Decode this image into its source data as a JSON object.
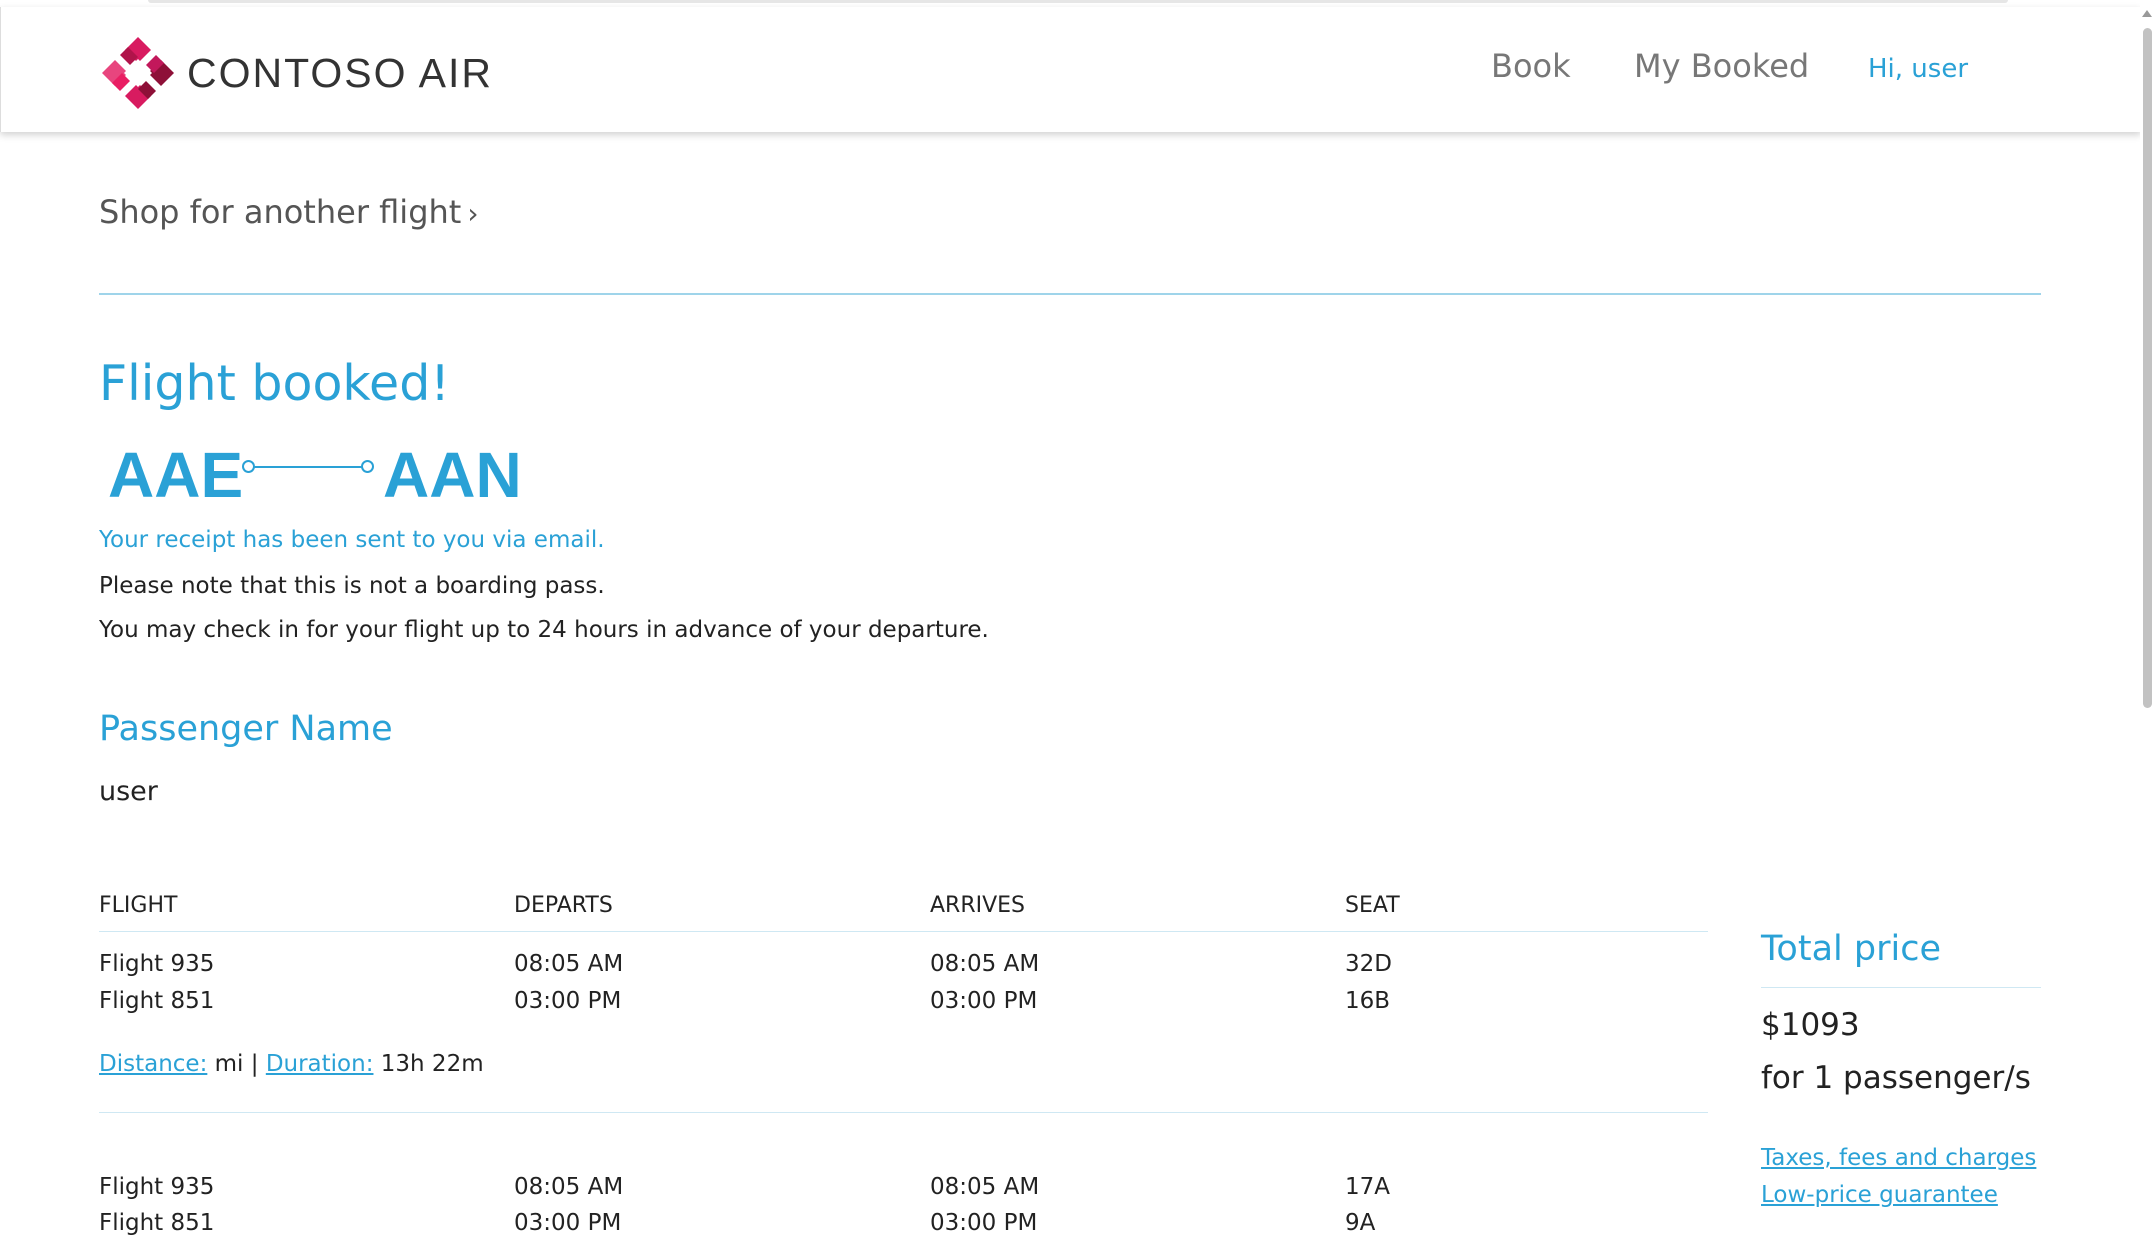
{
  "header": {
    "brand": "CONTOSO AIR",
    "nav": {
      "book": "Book",
      "my_booked": "My Booked"
    },
    "greeting": "Hi, user"
  },
  "shop_link": "Shop for another flight",
  "confirmation": {
    "title": "Flight booked!",
    "from_code": "AAE",
    "to_code": "AAN",
    "receipt": "Your receipt has been sent to you via email.",
    "note1": "Please note that this is not a boarding pass.",
    "note2": "You may check in for your flight up to 24 hours in advance of your departure."
  },
  "passenger": {
    "heading": "Passenger Name",
    "name": "user"
  },
  "table": {
    "headers": [
      "FLIGHT",
      "DEPARTS",
      "ARRIVES",
      "SEAT"
    ],
    "groups": [
      {
        "rows": [
          [
            "Flight 935",
            "08:05 AM",
            "08:05 AM",
            "32D"
          ],
          [
            "Flight 851",
            "03:00 PM",
            "03:00 PM",
            "16B"
          ]
        ],
        "distance_label": "Distance:",
        "distance_value": " mi",
        "separator": " | ",
        "duration_label": "Duration:",
        "duration_value": " 13h 22m"
      },
      {
        "rows": [
          [
            "Flight 935",
            "08:05 AM",
            "08:05 AM",
            "17A"
          ],
          [
            "Flight 851",
            "03:00 PM",
            "03:00 PM",
            "9A"
          ]
        ]
      }
    ]
  },
  "total": {
    "heading": "Total price",
    "amount": "$1093",
    "passengers": "for 1 passenger/s",
    "links": [
      "Taxes, fees and charges",
      "Low-price guarantee"
    ]
  },
  "colors": {
    "accent": "#2aa1d6",
    "logo_primary": "#d81b60",
    "logo_dark": "#8e1038",
    "text": "#222222",
    "nav": "#777777"
  }
}
